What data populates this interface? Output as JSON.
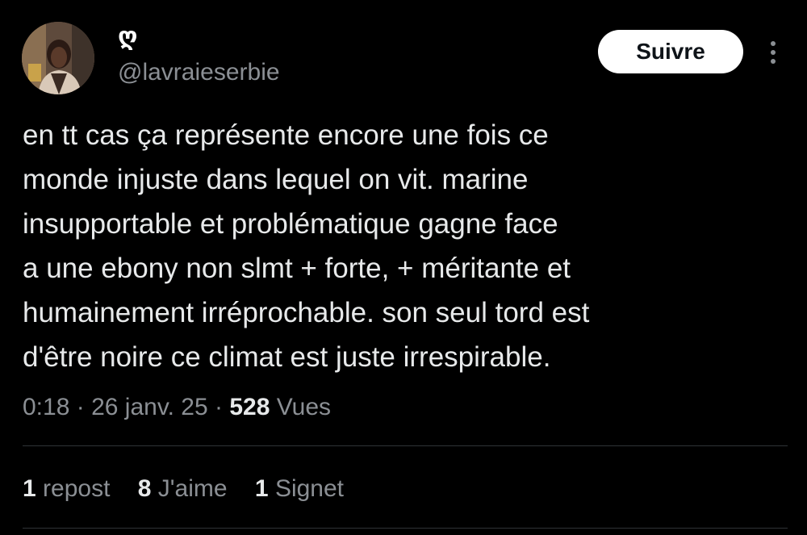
{
  "author": {
    "display_name": "ღ",
    "handle": "@lavraieserbie",
    "avatar_icon": "user-avatar-photo"
  },
  "header": {
    "follow_label": "Suivre",
    "more_icon": "more-vertical-icon"
  },
  "tweet": {
    "lines": [
      "en tt cas ça représente encore une fois ce",
      "monde injuste dans lequel on vit. marine",
      "insupportable et problématique gagne face",
      "a une ebony non slmt + forte, + méritante et",
      "humainement irréprochable. son seul tord est",
      "d'être noire ce climat est juste irrespirable."
    ]
  },
  "meta": {
    "time": "0:18",
    "separator": "·",
    "date": "26 janv. 25",
    "views_count": "528",
    "views_label": "Vues"
  },
  "stats": {
    "reposts_count": "1",
    "reposts_label": "repost",
    "likes_count": "8",
    "likes_label": "J'aime",
    "bookmarks_count": "1",
    "bookmarks_label": "Signet"
  },
  "colors": {
    "background": "#000000",
    "text_primary": "#e7e9ea",
    "text_secondary": "#8b8f94",
    "button_bg": "#ffffff",
    "divider": "#2f3336"
  }
}
